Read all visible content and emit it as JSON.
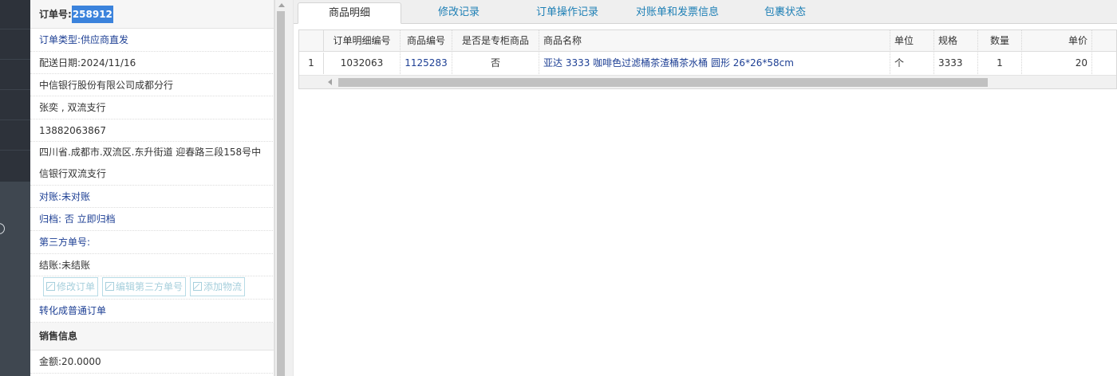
{
  "order_panel": {
    "order_no_label": "订单号:",
    "order_no_value": "258912",
    "order_type": "订单类型:供应商直发",
    "delivery_date": "配送日期:2024/11/16",
    "company": "中信银行股份有限公司成都分行",
    "contact": "张奕 , 双流支行",
    "phone": "13882063867",
    "address": "四川省.成都市.双流区.东升街道 迎春路三段158号中信银行双流支行",
    "reconcile": "对账:未对账",
    "archive": "归档: 否 立即归档",
    "third_party": "第三方单号:",
    "settlement": "结账:未结账",
    "buttons": {
      "edit_order": "修改订单",
      "edit_third": "编辑第三方单号",
      "add_logistics": "添加物流"
    },
    "convert_link": "转化成普通订单",
    "sales_section": "销售信息",
    "amount": "金额:20.0000"
  },
  "tabs": [
    {
      "label": "商品明细",
      "active": true
    },
    {
      "label": "修改记录",
      "active": false
    },
    {
      "label": "订单操作记录",
      "active": false
    },
    {
      "label": "对账单和发票信息",
      "active": false
    },
    {
      "label": "包裹状态",
      "active": false
    }
  ],
  "grid": {
    "headers": [
      "订单明细编号",
      "商品编号",
      "是否是专柜商品",
      "商品名称",
      "单位",
      "规格",
      "数量",
      "单价"
    ],
    "rows": [
      {
        "index": "1",
        "detail_no": "1032063",
        "goods_no": "1125283",
        "is_exclusive": "否",
        "name": "亚达 3333 咖啡色过滤桶茶渣桶茶水桶 圆形 26*26*58cm",
        "unit": "个",
        "spec": "3333",
        "qty": "1",
        "price": "20"
      }
    ]
  },
  "colors": {
    "link": "#1d3f94",
    "tab_link": "#1d7fb5",
    "highlight": "#3b83dc",
    "nav_bg": "#2d323a"
  },
  "icons": {
    "edit": "pencil-square-icon"
  }
}
